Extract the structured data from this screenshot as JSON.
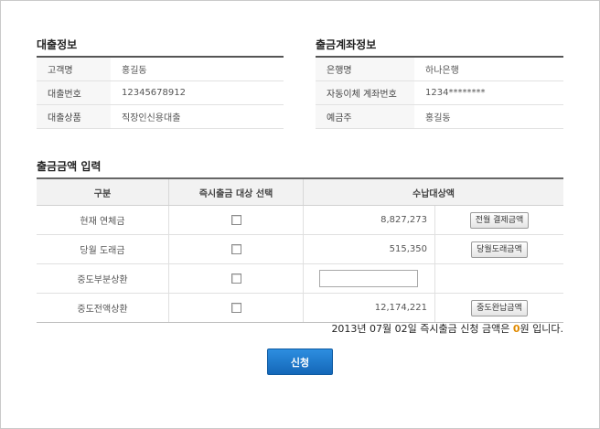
{
  "loan_info": {
    "title": "대출정보",
    "rows": [
      {
        "label": "고객명",
        "value": "홍길동"
      },
      {
        "label": "대출번호",
        "value": "12345678912"
      },
      {
        "label": "대출상품",
        "value": "직장인신용대출"
      }
    ]
  },
  "account_info": {
    "title": "출금계좌정보",
    "rows": [
      {
        "label": "은행명",
        "value": "하나은행"
      },
      {
        "label": "자동이체 계좌번호",
        "value": "1234********"
      },
      {
        "label": "예금주",
        "value": "홍길동"
      }
    ]
  },
  "amount": {
    "title": "출금금액 입력",
    "headers": [
      "구분",
      "즉시출금 대상 선택",
      "수납대상액"
    ],
    "rows": [
      {
        "category": "현재 연체금",
        "amount": "8,827,273",
        "button": "전월 결제금액",
        "checked": false
      },
      {
        "category": "당월 도래금",
        "amount": "515,350",
        "button": "당월도래금액",
        "checked": false
      },
      {
        "category": "중도부분상환",
        "amount": "",
        "button": "",
        "checked": false
      },
      {
        "category": "중도전액상환",
        "amount": "12,174,221",
        "button": "중도완납금액",
        "checked": false
      }
    ]
  },
  "summary": {
    "prefix": "2013년 07월 02일 즉시출금 신청 금액은 ",
    "value": "0",
    "suffix": "원 입니다."
  },
  "submit_label": "신청"
}
